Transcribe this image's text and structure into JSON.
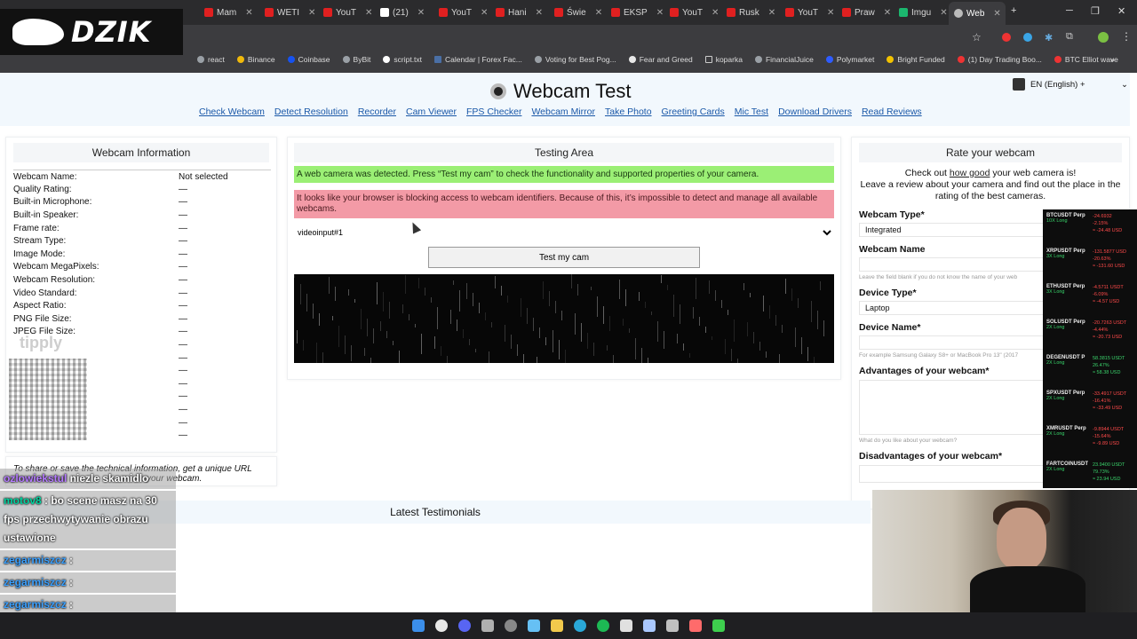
{
  "browser": {
    "tabs": [
      "Mam",
      "WETI",
      "YouT",
      "(21)",
      "YouT",
      "Hani",
      "Świe",
      "EKSP",
      "YouT",
      "Rusk",
      "YouT",
      "Praw",
      "Imgu",
      "Web"
    ],
    "bookmarks": [
      "react",
      "Binance",
      "Coinbase",
      "ByBit",
      "script.txt",
      "Calendar | Forex Fac...",
      "Voting for Best Pog...",
      "Fear and Greed",
      "koparka",
      "FinancialJuice",
      "Polymarket",
      "Bright Funded",
      "(1) Day Trading Boo...",
      "BTC Elliot wave"
    ],
    "new_tab": "+",
    "more_bookmarks": "»"
  },
  "logo": {
    "text": "DZIK"
  },
  "header": {
    "title": "Webcam Test",
    "nav": [
      "Check Webcam",
      "Detect Resolution",
      "Recorder",
      "Cam Viewer",
      "FPS Checker",
      "Webcam Mirror",
      "Take Photo",
      "Greeting Cards",
      "Mic Test",
      "Download Drivers",
      "Read Reviews"
    ],
    "language": "EN (English) +"
  },
  "info_panel": {
    "title": "Webcam Information",
    "rows": [
      [
        "Webcam Name:",
        "Not selected"
      ],
      [
        "Quality Rating:",
        "—"
      ],
      [
        "Built-in Microphone:",
        "—"
      ],
      [
        "Built-in Speaker:",
        "—"
      ],
      [
        "Frame rate:",
        "—"
      ],
      [
        "Stream Type:",
        "—"
      ],
      [
        "Image Mode:",
        "—"
      ],
      [
        "Webcam MegaPixels:",
        "—"
      ],
      [
        "Webcam Resolution:",
        "—"
      ],
      [
        "Video Standard:",
        "—"
      ],
      [
        "Aspect Ratio:",
        "—"
      ],
      [
        "PNG File Size:",
        "—"
      ],
      [
        "JPEG File Size:",
        "—"
      ],
      [
        "",
        "—"
      ],
      [
        "",
        "—"
      ],
      [
        "",
        "—"
      ],
      [
        "",
        "—"
      ],
      [
        "",
        "—"
      ],
      [
        "",
        "—"
      ],
      [
        "",
        "—"
      ],
      [
        "",
        "—"
      ]
    ]
  },
  "share": {
    "text": "To share or save the technical information, get a unique URL",
    "text2": "your webcam."
  },
  "testing": {
    "title": "Testing Area",
    "success": "A web camera was detected. Press “Test my cam” to check the functionality and supported properties of your camera.",
    "error": "It looks like your browser is blocking access to webcam identifiers. Because of this, it’s impossible to detect and manage all available webcams.",
    "device": "videoinput#1",
    "button": "Test my cam"
  },
  "rate": {
    "title": "Rate your webcam",
    "intro_pre": "Check out ",
    "intro_link": "how good",
    "intro_post": " your web camera is!",
    "intro2": "Leave a review about your camera and find out the place in the rating of the best cameras.",
    "webcam_type_label": "Webcam Type*",
    "webcam_type_value": "Integrated",
    "webcam_name_label": "Webcam Name",
    "webcam_name_hint": "Leave the field blank if you do not know the name of your web",
    "device_type_label": "Device Type*",
    "device_type_value": "Laptop",
    "device_name_label": "Device Name*",
    "device_name_hint": "For example Samsung Galaxy S8+ or MacBook Pro 13\" (2017",
    "advantages_label": "Advantages of your webcam*",
    "advantages_hint": "What do you like about your webcam?",
    "disadvantages_label": "Disadvantages of your webcam*"
  },
  "testimonials": {
    "title": "Latest Testimonials"
  },
  "overlay": {
    "tipply": "tipply",
    "chat": [
      {
        "user": "ozlowiekstul",
        "msg": " niezle skamidlo"
      },
      {
        "user": "motov8",
        "msg": " : bo scene masz na 30 fps przechwytywanie obrazu ustawione"
      },
      {
        "user": "zegarmiszcz",
        "msg": " :"
      },
      {
        "user": "zegarmiszcz",
        "msg": " :"
      },
      {
        "user": "zegarmiszcz",
        "msg": " :"
      }
    ],
    "ticker": [
      {
        "sym": "BTCUSDT Perp",
        "sub": "10X Long",
        "v": [
          "-24.6932",
          "-2.15%",
          "≈ -24.48 USD"
        ],
        "pos": false
      },
      {
        "sym": "XRPUSDT Perp",
        "sub": "3X Long",
        "v": [
          "-131.5877 USD",
          "-20.63%",
          "≈ -131.60 USD"
        ],
        "pos": false
      },
      {
        "sym": "ETHUSDT Perp",
        "sub": "3X Long",
        "v": [
          "-4.5711 USDT",
          "-6.09%",
          "≈ -4.57 USD"
        ],
        "pos": false
      },
      {
        "sym": "SOLUSDT Perp",
        "sub": "2X Long",
        "v": [
          "-20.7263 USDT",
          "-4.44%",
          "≈ -20.73 USD"
        ],
        "pos": false
      },
      {
        "sym": "DEGENUSDT P",
        "sub": "2X Long",
        "v": [
          "58.3815 USDT",
          "26.47%",
          "≈ 58.38 USD"
        ],
        "pos": true
      },
      {
        "sym": "SPXUSDT Perp",
        "sub": "2X Long",
        "v": [
          "-33.4917 USDT",
          "-16.41%",
          "≈ -33.49 USD"
        ],
        "pos": false
      },
      {
        "sym": "XMRUSDT Perp",
        "sub": "2X Long",
        "v": [
          "-9.8944 USDT",
          "-15.64%",
          "≈ -9.89 USD"
        ],
        "pos": false
      },
      {
        "sym": "FARTCOINUSDT",
        "sub": "2X Long",
        "v": [
          "23.9400 USDT",
          "79.73%",
          "≈ 23.94 USD"
        ],
        "pos": true
      }
    ]
  }
}
